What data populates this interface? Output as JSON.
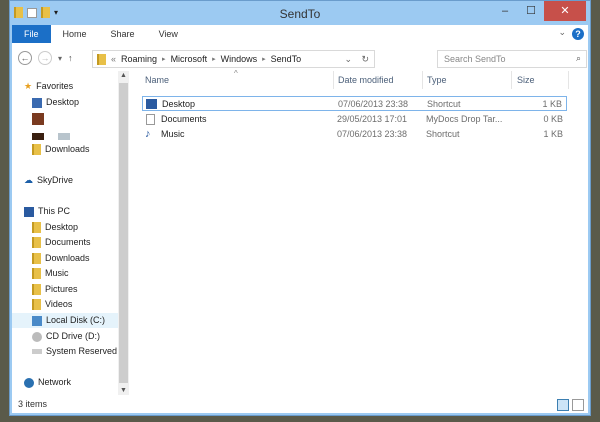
{
  "window": {
    "title": "SendTo",
    "minimize": "‒",
    "maximize": "☐",
    "close": "✕"
  },
  "ribbon": {
    "tabs": [
      "File",
      "Home",
      "Share",
      "View"
    ],
    "help": "?",
    "expand": "⌄"
  },
  "address": {
    "back": "←",
    "forward": "→",
    "recent": "▾",
    "up": "↑",
    "prefix": "«",
    "crumbs": [
      "Roaming",
      "Microsoft",
      "Windows",
      "SendTo"
    ],
    "dropdown": "⌄",
    "refresh": "↻"
  },
  "search": {
    "placeholder": "Search SendTo",
    "icon": "⌕"
  },
  "nav_pane": {
    "favorites": "Favorites",
    "fav_items": [
      "Desktop",
      "Downloads"
    ],
    "skydrive": "SkyDrive",
    "this_pc": "This PC",
    "pc_items": [
      "Desktop",
      "Documents",
      "Downloads",
      "Music",
      "Pictures",
      "Videos",
      "Local Disk (C:)",
      "CD Drive (D:)",
      "System Reserved"
    ],
    "network": "Network"
  },
  "columns": [
    "Name",
    "Date modified",
    "Type",
    "Size"
  ],
  "files": [
    {
      "name": "Desktop",
      "date": "07/06/2013 23:38",
      "type": "Shortcut",
      "size": "1 KB"
    },
    {
      "name": "Documents",
      "date": "29/05/2013 17:01",
      "type": "MyDocs Drop Tar...",
      "size": "0 KB"
    },
    {
      "name": "Music",
      "date": "07/06/2013 23:38",
      "type": "Shortcut",
      "size": "1 KB"
    }
  ],
  "status": {
    "count": "3 items"
  },
  "sort_indicator": "^"
}
